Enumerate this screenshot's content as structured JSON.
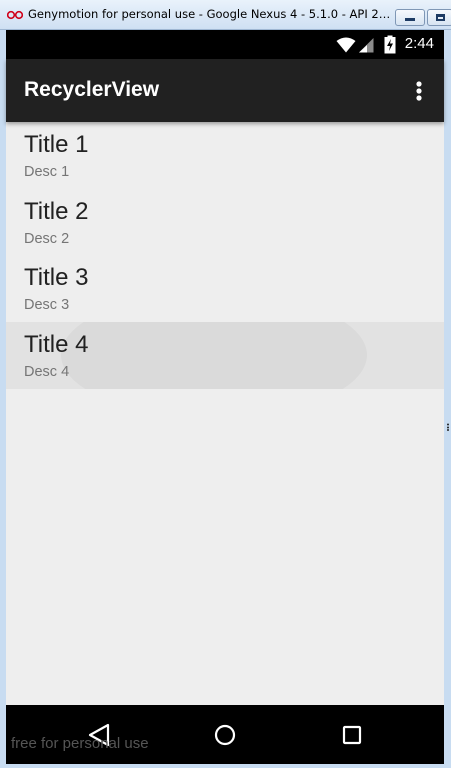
{
  "window": {
    "title": "Genymotion for personal use - Google Nexus 4 - 5.1.0 - API 22 - 768...",
    "icons": {
      "app": "genymotion-logo-icon",
      "minimize": "minimize-icon",
      "maximize": "maximize-icon"
    }
  },
  "status_bar": {
    "time": "2:44",
    "icons": [
      "wifi-icon",
      "cell-signal-icon",
      "battery-charging-icon"
    ]
  },
  "toolbar": {
    "title": "RecyclerView",
    "overflow_icon": "more-vert-icon"
  },
  "list": {
    "items": [
      {
        "title": "Title 1",
        "desc": "Desc 1",
        "pressed": false
      },
      {
        "title": "Title 2",
        "desc": "Desc 2",
        "pressed": false
      },
      {
        "title": "Title 3",
        "desc": "Desc 3",
        "pressed": false
      },
      {
        "title": "Title 4",
        "desc": "Desc 4",
        "pressed": true
      }
    ]
  },
  "nav_bar": {
    "icons": [
      "back-icon",
      "home-icon",
      "recents-icon"
    ],
    "watermark": "free for personal use"
  },
  "colors": {
    "toolbar": "#212121",
    "content_bg": "#eeeeee",
    "pressed_bg": "#e2e2e2",
    "title_text": "#212121",
    "desc_text": "#757575"
  }
}
